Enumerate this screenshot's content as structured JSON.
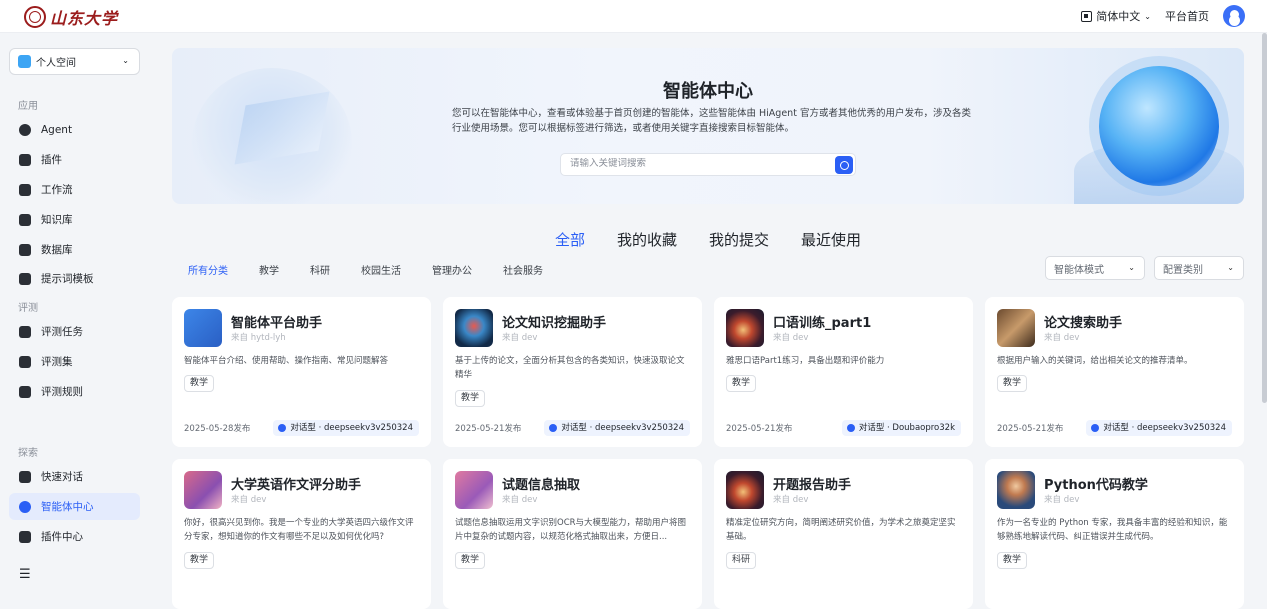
{
  "header": {
    "logo_text": "山东大学",
    "lang_label": "简体中文",
    "platform_home": "平台首页"
  },
  "sidebar": {
    "space_label": "个人空间",
    "section_app": "应用",
    "section_eval": "评测",
    "section_explore": "探索",
    "items": [
      {
        "label": "Agent"
      },
      {
        "label": "插件"
      },
      {
        "label": "工作流"
      },
      {
        "label": "知识库"
      },
      {
        "label": "数据库"
      },
      {
        "label": "提示词模板"
      },
      {
        "label": "评测任务"
      },
      {
        "label": "评测集"
      },
      {
        "label": "评测规则"
      },
      {
        "label": "快速对话"
      },
      {
        "label": "智能体中心"
      },
      {
        "label": "插件中心"
      }
    ]
  },
  "banner": {
    "title": "智能体中心",
    "desc": "您可以在智能体中心，查看或体验基于首页创建的智能体，这些智能体由 HiAgent 官方或者其他优秀的用户发布，涉及各类行业使用场景。您可以根据标签进行筛选，或者使用关键字直接搜索目标智能体。",
    "search_placeholder": "请输入关键词搜索"
  },
  "tabs": [
    "全部",
    "我的收藏",
    "我的提交",
    "最近使用"
  ],
  "categories": [
    "所有分类",
    "教学",
    "科研",
    "校园生活",
    "管理办公",
    "社会服务"
  ],
  "filters": {
    "mode": "智能体模式",
    "config": "配置类别"
  },
  "cards": [
    {
      "title": "智能体平台助手",
      "source": "来自 hytd-lyh",
      "desc": "智能体平台介绍、使用帮助、操作指南、常见问题解答",
      "tag": "教学",
      "date": "2025-05-28发布",
      "model": "对话型 · deepseekv3v250324"
    },
    {
      "title": "论文知识挖掘助手",
      "source": "来自 dev",
      "desc": "基于上传的论文，全面分析其包含的各类知识，快速汲取论文精华",
      "tag": "教学",
      "date": "2025-05-21发布",
      "model": "对话型 · deepseekv3v250324"
    },
    {
      "title": "口语训练_part1",
      "source": "来自 dev",
      "desc": "雅思口语Part1练习，具备出题和评价能力",
      "tag": "教学",
      "date": "2025-05-21发布",
      "model": "对话型 · Doubaopro32k"
    },
    {
      "title": "论文搜索助手",
      "source": "来自 dev",
      "desc": "根据用户输入的关键词，给出相关论文的推荐清单。",
      "tag": "教学",
      "date": "2025-05-21发布",
      "model": "对话型 · deepseekv3v250324"
    },
    {
      "title": "大学英语作文评分助手",
      "source": "来自 dev",
      "desc": "你好，很高兴见到你。我是一个专业的大学英语四六级作文评分专家，想知道你的作文有哪些不足以及如何优化吗?",
      "tag": "教学",
      "date": "",
      "model": ""
    },
    {
      "title": "试题信息抽取",
      "source": "来自 dev",
      "desc": "试题信息抽取运用文字识别OCR与大模型能力，帮助用户将图片中复杂的试题内容，以规范化格式抽取出来，方便日...",
      "tag": "教学",
      "date": "",
      "model": ""
    },
    {
      "title": "开题报告助手",
      "source": "来自 dev",
      "desc": "精准定位研究方向，简明阐述研究价值，为学术之旅奠定坚实基础。",
      "tag": "科研",
      "date": "",
      "model": ""
    },
    {
      "title": "Python代码教学",
      "source": "来自 dev",
      "desc": "作为一名专业的 Python 专家，我具备丰富的经验和知识，能够熟练地解读代码、纠正错误并生成代码。",
      "tag": "教学",
      "date": "",
      "model": ""
    }
  ],
  "colors": {
    "accent": "#2b5ff5",
    "brand": "#9b1c1c"
  }
}
